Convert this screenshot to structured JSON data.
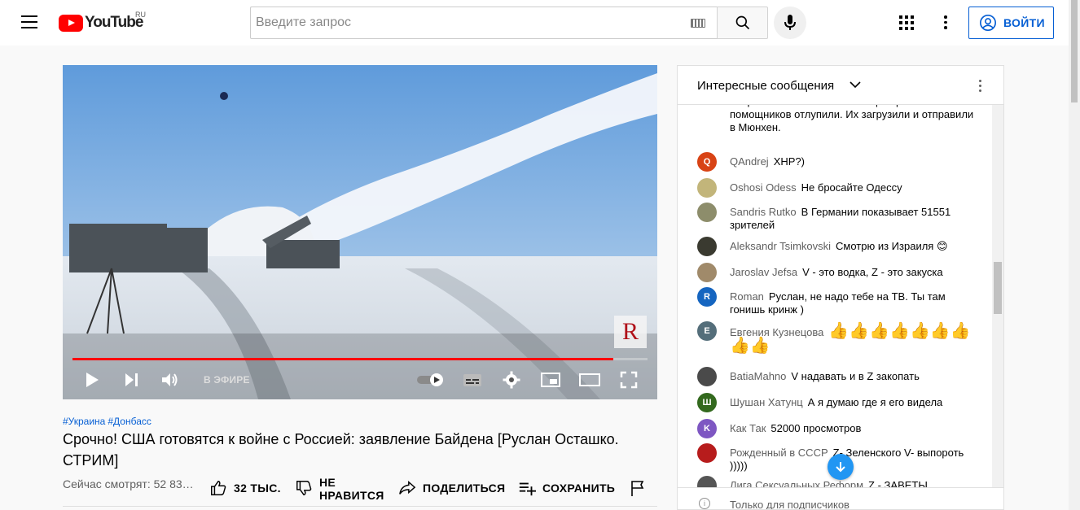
{
  "masthead": {
    "logo_text": "YouTube",
    "region": "RU",
    "search_placeholder": "Введите запрос",
    "signin_label": "ВОЙТИ"
  },
  "player": {
    "live_label": "В ЭФИРЕ",
    "watermark_text": "R",
    "progress_fraction": 0.94
  },
  "video": {
    "hashtags": [
      "#Украина",
      "#Донбасс"
    ],
    "title": "Срочно! США готовятся к войне с Россией: заявление Байдена [Руслан Осташко. СТРИМ]",
    "views": "Сейчас смотрят: 52 833 ...",
    "likes": "32 ТЫС.",
    "dislike_line1": "НЕ",
    "dislike_line2": "НРАВИТСЯ",
    "share": "ПОДЕЛИТЬСЯ",
    "save": "СОХРАНИТЬ"
  },
  "chat": {
    "title": "Интересные сообщения",
    "footer": "Только для подписчиков",
    "messages": [
      {
        "avatar": "",
        "color": "",
        "author": "",
        "text": "понравилось жильё. Они всё разгромили и помощников отлупили. Их загрузили и отправили в Мюнхен."
      },
      {
        "avatar": "Q",
        "color": "#d84315",
        "author": "QAndrej",
        "text": "ХНР?)"
      },
      {
        "avatar": "",
        "color": "#c2b57a",
        "author": "Oshosi Odess",
        "text": "Не бросайте Одессу"
      },
      {
        "avatar": "",
        "color": "#8d8d6b",
        "author": "Sandris Rutko",
        "text": "В Германии показывает 51551 зрителей"
      },
      {
        "avatar": "",
        "color": "#3a3a30",
        "author": "Aleksandr Tsimkovski",
        "text": "Смотрю из Израиля 😊"
      },
      {
        "avatar": "",
        "color": "#a08a6a",
        "author": "Jaroslav Jefsa",
        "text": "V - это водка, Z - это закуска"
      },
      {
        "avatar": "R",
        "color": "#1565c0",
        "author": "Roman",
        "text": "Руслан, не надо тебе на ТВ. Ты там гонишь кринж )"
      },
      {
        "avatar": "Е",
        "color": "#546e7a",
        "author": "Евгения Кузнецова",
        "text": "👍👍👍👍👍👍👍👍👍"
      },
      {
        "avatar": "",
        "color": "#4a4a4a",
        "author": "BatiaMahno",
        "text": "V надавать и в Z закопать"
      },
      {
        "avatar": "Ш",
        "color": "#33691e",
        "author": "Шушан Хатунц",
        "text": "А я думаю где я его видела"
      },
      {
        "avatar": "K",
        "color": "#7e57c2",
        "author": "Как Так",
        "text": "52000 просмотров"
      },
      {
        "avatar": "",
        "color": "#b71c1c",
        "author": "Рожденный в СССР",
        "text": "Z- Зеленского V- выпороть )))))"
      },
      {
        "avatar": "",
        "color": "#555555",
        "author": "Лига Сексуальных Реформ",
        "text": "Z - ЗАВЕТЫ"
      }
    ]
  }
}
